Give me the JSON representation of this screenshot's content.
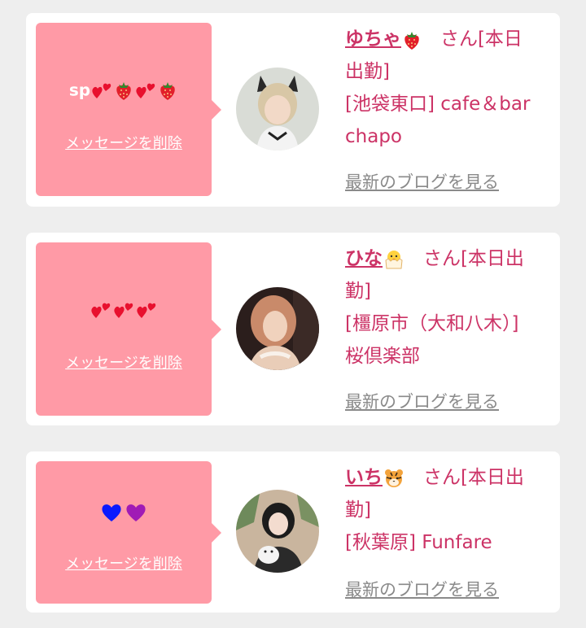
{
  "cards": [
    {
      "message_text": "sp",
      "message_icons": [
        "two-hearts",
        "strawberry",
        "two-hearts",
        "strawberry"
      ],
      "delete_label": "メッセージを削除",
      "name": "ゆちゃ",
      "name_icon": "strawberry",
      "san": "さん",
      "status": "[本日出勤]",
      "shop": "[池袋東口] cafe＆bar chapo",
      "blog_label": "最新のブログを見る"
    },
    {
      "message_text": "",
      "message_icons": [
        "two-hearts",
        "two-hearts",
        "two-hearts"
      ],
      "delete_label": "メッセージを削除",
      "name": "ひな",
      "name_icon": "hatching-chick",
      "san": "さん",
      "status": "[本日出勤]",
      "shop": "[橿原市（大和八木）] 桜倶楽部",
      "blog_label": "最新のブログを見る"
    },
    {
      "message_text": "",
      "message_icons": [
        "blue-heart",
        "purple-heart"
      ],
      "delete_label": "メッセージを削除",
      "name": "いち",
      "name_icon": "tiger-face",
      "san": "さん",
      "status": "[本日出勤]",
      "shop": "[秋葉原] Funfare",
      "blog_label": "最新のブログを見る"
    }
  ],
  "colors": {
    "page_bg": "#eeeeee",
    "card_bg": "#ffffff",
    "bubble_bg": "#ff9aa6",
    "accent": "#cc3366",
    "blog_link": "#8a8a8a",
    "heart_red": "#e8102e",
    "heart_blue": "#0a1aff",
    "heart_purple": "#a01bb5"
  }
}
